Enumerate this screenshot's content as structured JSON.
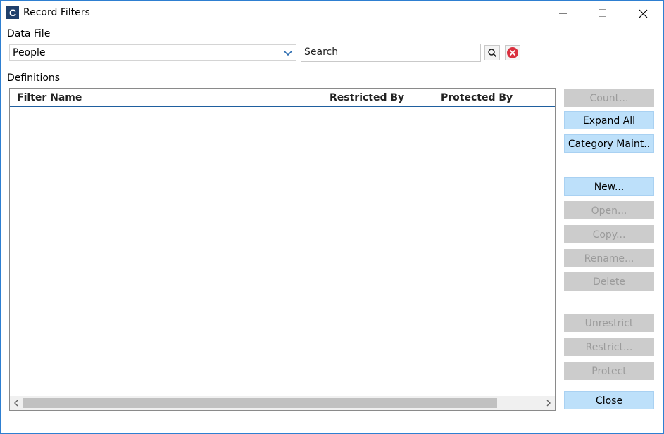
{
  "window": {
    "title": "Record Filters",
    "app_icon_letter": "C"
  },
  "data_file": {
    "label": "Data File",
    "selected": "People"
  },
  "search": {
    "placeholder": "Search"
  },
  "definitions": {
    "label": "Definitions",
    "columns": [
      "Filter Name",
      "Restricted By",
      "Protected By"
    ],
    "rows": []
  },
  "buttons": {
    "count": {
      "label": "Count...",
      "enabled": false
    },
    "expand_all": {
      "label": "Expand All",
      "enabled": true
    },
    "category_maint": {
      "label": "Category Maint..",
      "enabled": true
    },
    "new": {
      "label": "New...",
      "enabled": true
    },
    "open": {
      "label": "Open...",
      "enabled": false
    },
    "copy": {
      "label": "Copy...",
      "enabled": false
    },
    "rename": {
      "label": "Rename...",
      "enabled": false
    },
    "delete": {
      "label": "Delete",
      "enabled": false
    },
    "unrestrict": {
      "label": "Unrestrict",
      "enabled": false
    },
    "restrict": {
      "label": "Restrict...",
      "enabled": false
    },
    "protect": {
      "label": "Protect",
      "enabled": false
    },
    "close": {
      "label": "Close",
      "enabled": true
    }
  },
  "icons": {
    "app": "app-logo-icon",
    "minimize": "minimize-icon",
    "maximize": "maximize-icon",
    "close": "close-icon",
    "dropdown": "chevron-down-icon",
    "search": "magnifier-icon",
    "clear": "clear-x-icon"
  },
  "colors": {
    "accent_button": "#bde0fa",
    "disabled_button": "#cccccc",
    "clear_icon": "#d9303e",
    "window_border": "#2e7fd1"
  }
}
